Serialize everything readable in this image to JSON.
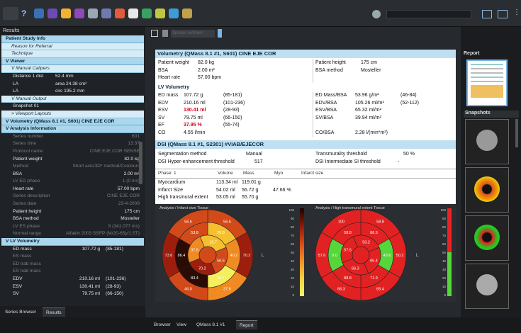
{
  "toolbar": {
    "icons": [
      "help-icon",
      "module-1-icon",
      "module-2-icon",
      "module-3-icon",
      "module-4-icon",
      "module-5-icon",
      "module-6-icon",
      "module-7-icon",
      "module-8-icon",
      "module-9-icon",
      "module-10-icon",
      "module-11-icon",
      "module-12-icon",
      "module-13-icon",
      "module-14-icon"
    ],
    "colors": [
      "#3b6fb6",
      "#6e4bb2",
      "#f2b233",
      "#8f49b8",
      "#9aa7b6",
      "#6f7ab0",
      "#e25b3d",
      "#e8e8e8",
      "#37a35f",
      "#bfc840",
      "#3e9bd6",
      "#c1a14a"
    ]
  },
  "left_header": "Results",
  "left_items": [
    {
      "type": "hdr",
      "label": "Patient Study Info"
    },
    {
      "type": "sub",
      "label": "Reason for Referral"
    },
    {
      "type": "sub",
      "label": "Technique"
    },
    {
      "type": "hdr",
      "label": "V Viewer"
    },
    {
      "type": "sub",
      "label": "V Manual Calipers"
    },
    {
      "type": "kv2",
      "k": "Distance 1 dist",
      "v": "52.4 mm"
    },
    {
      "type": "kv2",
      "k": "LA",
      "v": "area   24.38 cm²"
    },
    {
      "type": "kv2",
      "k": "LA",
      "v": "circ   195.2 mm",
      "dim": true
    },
    {
      "type": "sub",
      "label": "V Manual Output"
    },
    {
      "type": "kv2",
      "k": "Snapshot 01",
      "v": ""
    },
    {
      "type": "sub",
      "label": "> Viewport Layouts"
    },
    {
      "type": "hdr",
      "label": "V Volumetry (QMass 8.1 #1, S601) CINE EJE COR"
    },
    {
      "type": "hdr",
      "label": "V Analysis Information"
    },
    {
      "type": "kv",
      "k": "Series number",
      "v": "601",
      "dim": true
    },
    {
      "type": "kv",
      "k": "Series time",
      "v": "13:37",
      "dim": true
    },
    {
      "type": "kv",
      "k": "Protocol name",
      "v": "CINE EJE COR SENSE",
      "dim": true
    },
    {
      "type": "kv",
      "k": "Patient weight",
      "v": "82.0 kg"
    },
    {
      "type": "kv",
      "k": "Method",
      "v": "Short axis/3D* method/Contours",
      "dim": true
    },
    {
      "type": "kv",
      "k": "BSA",
      "v": "2.00 m²"
    },
    {
      "type": "kv",
      "k": "LV ED phase",
      "v": "1 (0 ms)",
      "dim": true
    },
    {
      "type": "kv",
      "k": "Heart rate",
      "v": "57.00 bpm"
    },
    {
      "type": "kv",
      "k": "Series description",
      "v": "CINE EJE COR",
      "dim": true
    },
    {
      "type": "kv",
      "k": "Series date",
      "v": "23-4-2009",
      "dim": true
    },
    {
      "type": "kv",
      "k": "Patient height",
      "v": "175 cm"
    },
    {
      "type": "kv",
      "k": "BSA method",
      "v": "Mosteller"
    },
    {
      "type": "kv",
      "k": "LV ES phase",
      "v": "9 (341.077 ms)",
      "dim": true
    },
    {
      "type": "kv",
      "k": "Normal range",
      "v": "Alfakih 2003 SSFP (M/20-65y/1.5T)",
      "dim": true
    },
    {
      "type": "hdr",
      "label": "V LV Volumetry"
    },
    {
      "type": "kv",
      "k": "ED mass",
      "v": "107.72 g",
      "r": "(85-181)"
    },
    {
      "type": "kv",
      "k": "ES mass",
      "v": "",
      "dim": true
    },
    {
      "type": "kv",
      "k": "ED trab mass",
      "v": "",
      "dim": true
    },
    {
      "type": "kv",
      "k": "ES trab mass",
      "v": "",
      "dim": true
    },
    {
      "type": "kv",
      "k": "EDV",
      "v": "210.16 ml",
      "r": "(101-236)"
    },
    {
      "type": "kv",
      "k": "ESV",
      "v": "130.41 ml",
      "r": "(28-93)"
    },
    {
      "type": "kv",
      "k": "SV",
      "v": "79.75 ml",
      "r": "(66-150)"
    }
  ],
  "left_tabs": [
    "Series Browser",
    "Results"
  ],
  "mid_toolbar": {
    "placeholder": "Spaces outlined"
  },
  "doc": {
    "vol_title": "Volumetry (QMass 8.1 #1, S601) CINE EJE COR",
    "pw_k": "Patient weight",
    "pw_v": "82.0 kg",
    "ph_k": "Patient height",
    "ph_v": "175 cm",
    "bsa_k": "BSA",
    "bsa_v": "2.00 m²",
    "bm_k": "BSA method",
    "bm_v": "Mosteller",
    "hr_k": "Heart rate",
    "hr_v": "57.00 bpm",
    "lv_title": "LV Volumetry",
    "lv_left": [
      {
        "k": "ED mass",
        "v": "107.72 g",
        "r": "(85-181)"
      },
      {
        "k": "EDV",
        "v": "210.16 ml",
        "r": "(101-236)"
      },
      {
        "k": "ESV",
        "v": "130.41 ml",
        "r": "(28-93)",
        "red": true
      },
      {
        "k": "SV",
        "v": "79.75 ml",
        "r": "(66-150)"
      },
      {
        "k": "EF",
        "v": "37.95 %",
        "r": "(55-74)",
        "red": true
      },
      {
        "k": "CO",
        "v": "4.55 l/min",
        "r": ""
      }
    ],
    "lv_right": [
      {
        "k": "ED Mass/BSA",
        "v": "53.96 g/m²",
        "r": "(46-84)"
      },
      {
        "k": "EDV/BSA",
        "v": "105.26 ml/m²",
        "r": "(52-112)"
      },
      {
        "k": "ESV/BSA",
        "v": "65.32 ml/m²",
        "r": ""
      },
      {
        "k": "SV/BSA",
        "v": "39.94 ml/m²",
        "r": ""
      },
      {
        "k": "",
        "v": "",
        "r": ""
      },
      {
        "k": "CO/BSA",
        "v": "2.28 l/(min*m²)",
        "r": ""
      }
    ],
    "dsi_title": "DSI (QMass 8.1 #1, S2301) #VIAB/EJECOR",
    "seg_k": "Segmentation method",
    "seg_v": "Manual",
    "tt_k": "Transmurality threshold",
    "tt_v": "50 %",
    "dsh_k": "DSI Hyper-enhancement threshold",
    "dsh_v": "517",
    "dsi_k": "DSI Intermediate SI threshold",
    "dsi_v": "-",
    "tbl_head": [
      "Phase: 1",
      "Volume",
      "Mass",
      "Myo",
      "Infarct size"
    ],
    "tbl_rows": [
      [
        "Myocardium",
        "113.34 ml",
        "119.01 g",
        "",
        ""
      ],
      [
        "Infarct Size",
        "54.02 ml",
        "56.72 g",
        "47.66 %",
        ""
      ],
      [
        "High transmural extent",
        "53.05 ml",
        "55.70 g",
        "",
        ""
      ]
    ],
    "bull1_title": "Analysis / Infarct size Tissue",
    "bull2_title": "Analysis / High transmural extent Tissue",
    "bull1_vals": [
      "56.6",
      "70.2",
      "37.6",
      "46.0",
      "73.6",
      "56.6",
      "28.8",
      "40.2",
      "16.7",
      "83.4",
      "86.4",
      "53.8",
      "18.7"
    ],
    "bull2_vals": [
      "58.8",
      "50.2",
      "65.4",
      "66.3",
      "57.6",
      "100",
      "86.9",
      "43.6",
      "71.9",
      "88.8",
      "0.0"
    ],
    "scale_ticks": [
      "100",
      "90",
      "80",
      "70",
      "60",
      "50",
      "40",
      "30",
      "20",
      "10",
      "0"
    ],
    "L": "L"
  },
  "right": {
    "report_label": "Report",
    "snapshots_label": "Snapshots"
  },
  "bottom_tabs": [
    "Browser",
    "View",
    "QMass 8.1 #1",
    "Report"
  ]
}
